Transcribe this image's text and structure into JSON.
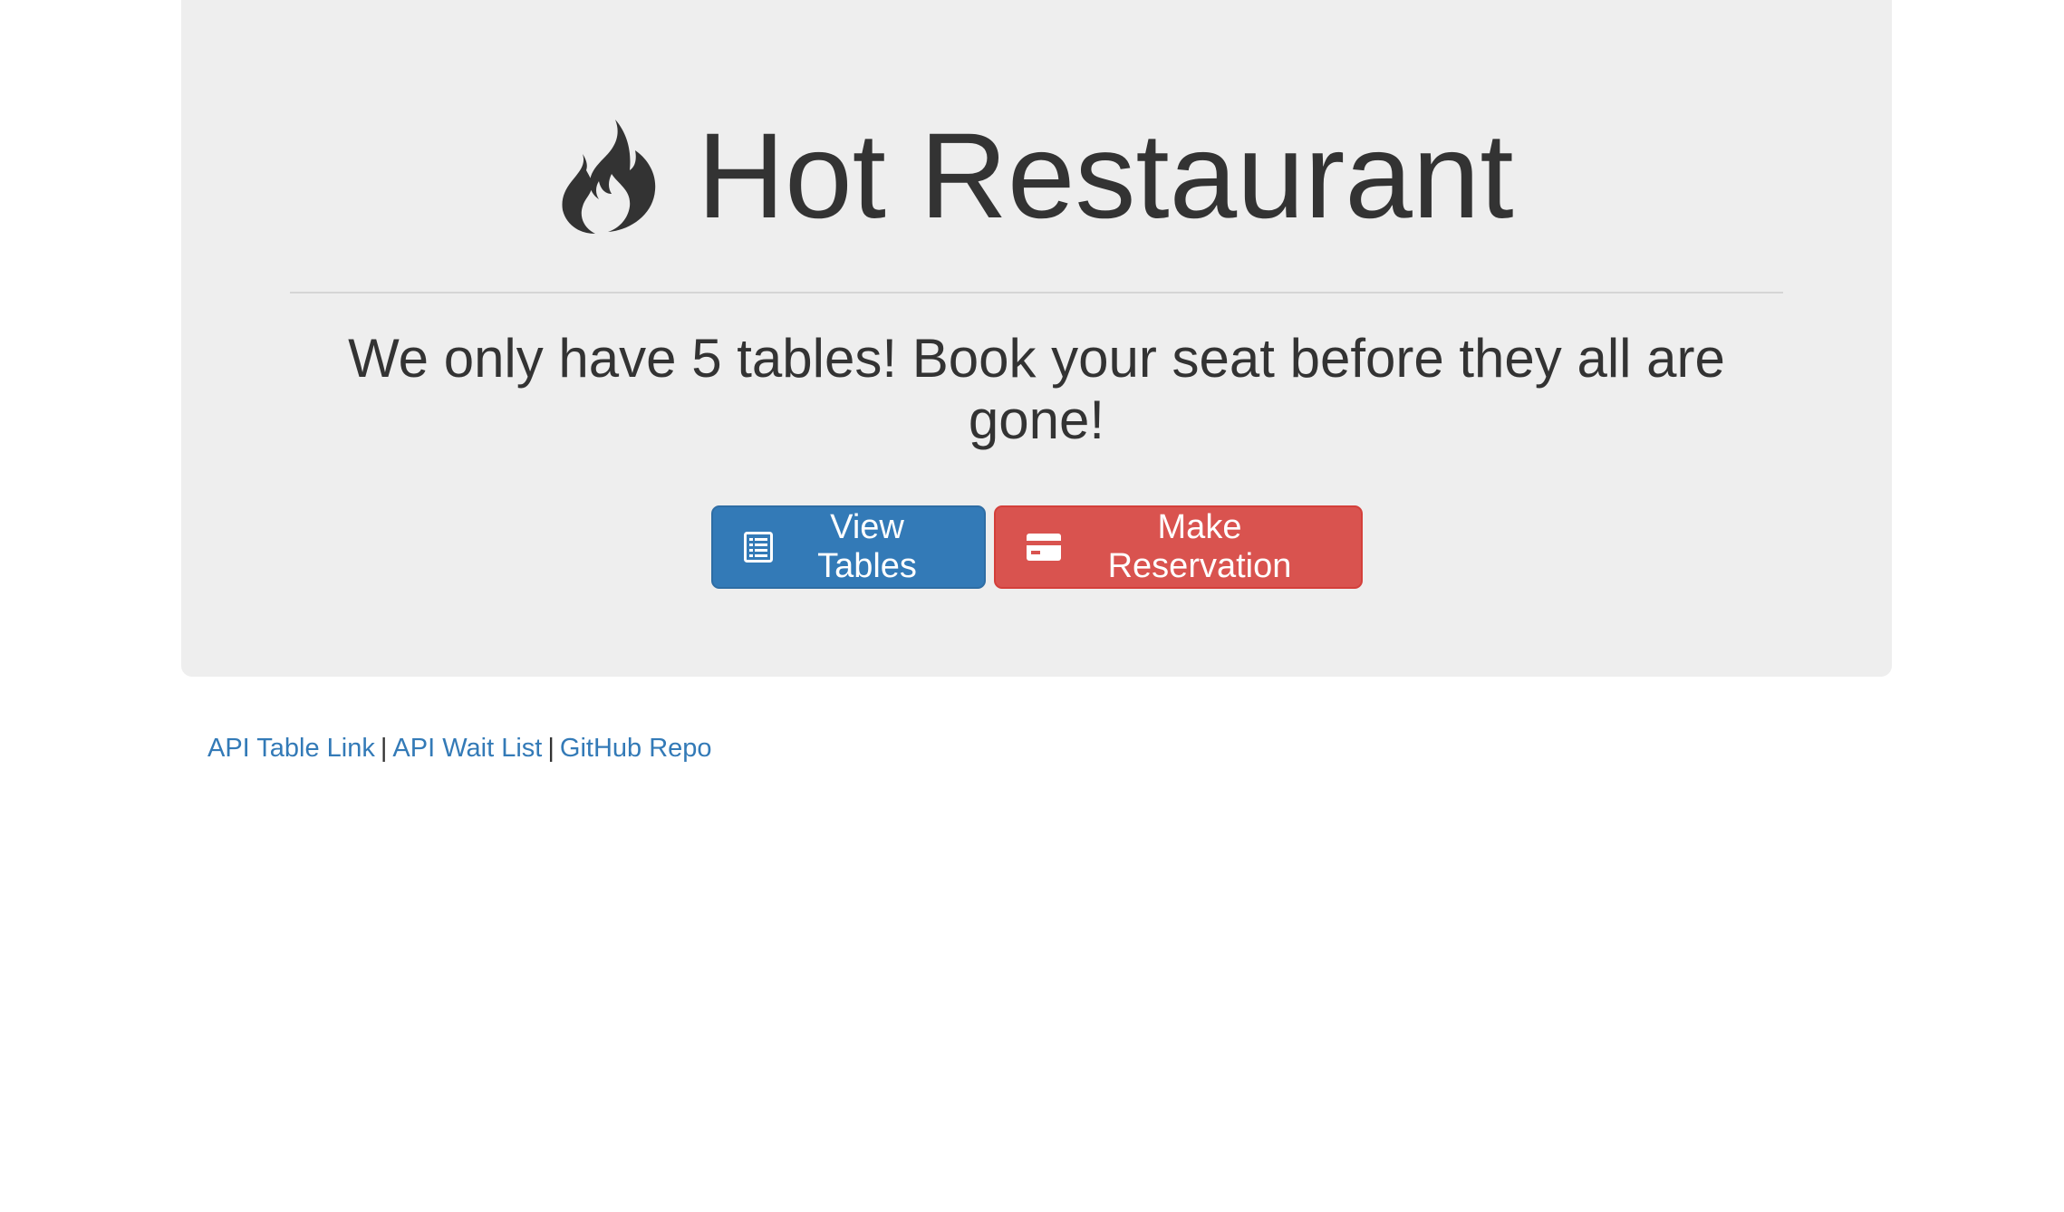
{
  "hero": {
    "icon": "fire-icon",
    "title": "Hot Restaurant",
    "tagline": "We only have 5 tables! Book your seat before they all are gone!"
  },
  "buttons": {
    "view_tables": {
      "label": "View Tables",
      "icon": "list-alt-icon",
      "color": "#337ab7"
    },
    "make_reservation": {
      "label": "Make Reservation",
      "icon": "credit-card-icon",
      "color": "#d9534f"
    }
  },
  "footer": {
    "links": [
      {
        "label": "API Table Link"
      },
      {
        "label": "API Wait List"
      },
      {
        "label": "GitHub Repo"
      }
    ],
    "separator": "|"
  },
  "colors": {
    "jumbotron_bg": "#eeeeee",
    "text": "#333333",
    "link": "#337ab7"
  }
}
